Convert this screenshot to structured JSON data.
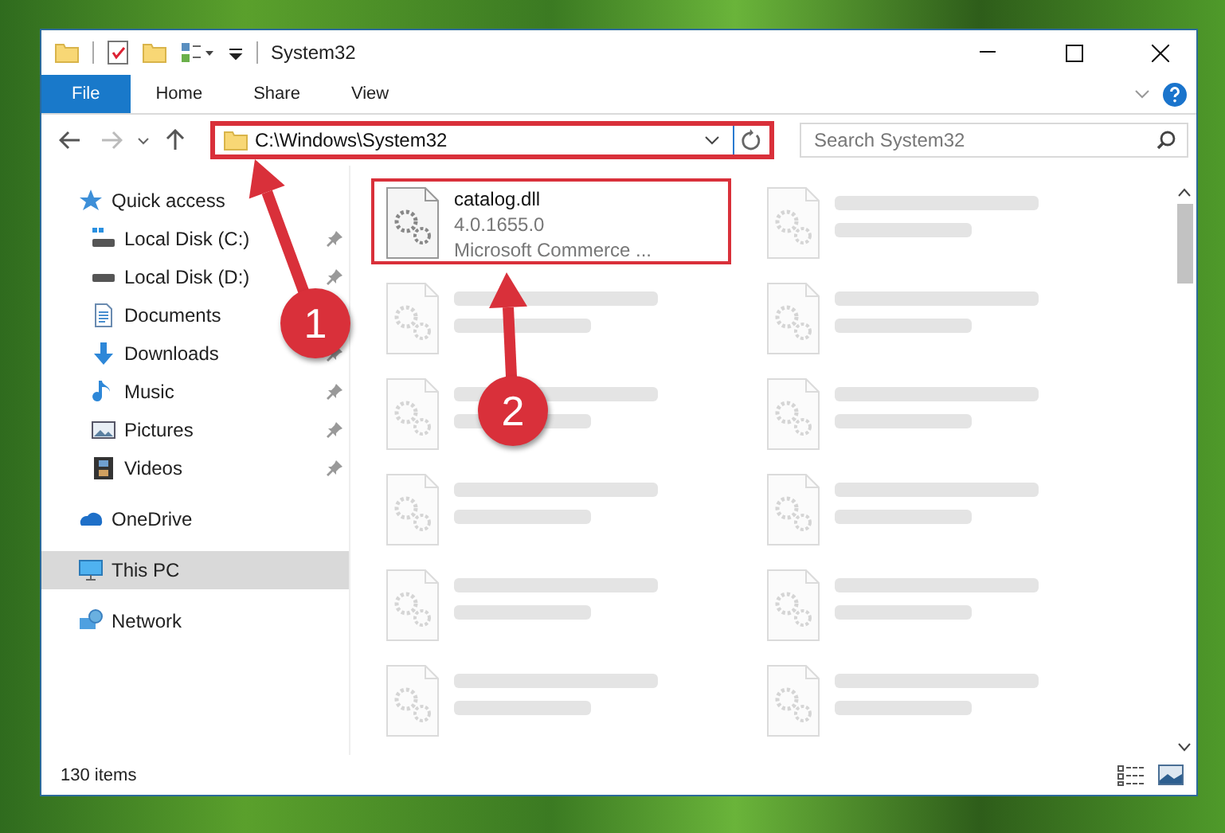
{
  "window": {
    "title": "System32"
  },
  "ribbon_tabs": [
    {
      "label": "File",
      "selected": true
    },
    {
      "label": "Home",
      "selected": false
    },
    {
      "label": "Share",
      "selected": false
    },
    {
      "label": "View",
      "selected": false
    }
  ],
  "address_bar": {
    "path": "C:\\Windows\\System32",
    "highlighted": true
  },
  "search": {
    "placeholder": "Search System32"
  },
  "sidebar": {
    "items": [
      {
        "label": "Quick access",
        "kind": "star",
        "pinned": false,
        "selected": false,
        "children": [
          {
            "label": "Local Disk (C:)",
            "kind": "drive-c",
            "pinned": true,
            "selected": false
          },
          {
            "label": "Local Disk (D:)",
            "kind": "drive",
            "pinned": true,
            "selected": false
          },
          {
            "label": "Documents",
            "kind": "documents",
            "selected": false
          },
          {
            "label": "Downloads",
            "kind": "downloads",
            "pinned": true,
            "selected": false
          },
          {
            "label": "Music",
            "kind": "music",
            "pinned": true,
            "selected": false
          },
          {
            "label": "Pictures",
            "kind": "pictures",
            "pinned": true,
            "selected": false
          },
          {
            "label": "Videos",
            "kind": "videos",
            "pinned": true,
            "selected": false
          }
        ]
      },
      {
        "label": "OneDrive",
        "kind": "cloud",
        "pinned": false,
        "selected": false
      },
      {
        "label": "This PC",
        "kind": "pc",
        "pinned": false,
        "selected": true
      },
      {
        "label": "Network",
        "kind": "network",
        "pinned": false,
        "selected": false
      }
    ]
  },
  "files": [
    {
      "name": "catalog.dll",
      "lines": [
        "4.0.1655.0",
        "Microsoft Commerce ..."
      ],
      "highlighted": true,
      "blurred": false
    },
    {
      "highlighted": false,
      "blurred": true
    },
    {
      "highlighted": false,
      "blurred": true
    },
    {
      "highlighted": false,
      "blurred": true
    },
    {
      "highlighted": false,
      "blurred": true
    },
    {
      "highlighted": false,
      "blurred": true
    },
    {
      "highlighted": false,
      "blurred": true
    },
    {
      "highlighted": false,
      "blurred": true
    },
    {
      "highlighted": false,
      "blurred": true
    },
    {
      "highlighted": false,
      "blurred": true
    },
    {
      "highlighted": false,
      "blurred": true
    },
    {
      "highlighted": false,
      "blurred": true
    }
  ],
  "status_bar": {
    "item_count": "130 items"
  },
  "annotations": [
    {
      "label": "1"
    },
    {
      "label": "2"
    }
  ]
}
